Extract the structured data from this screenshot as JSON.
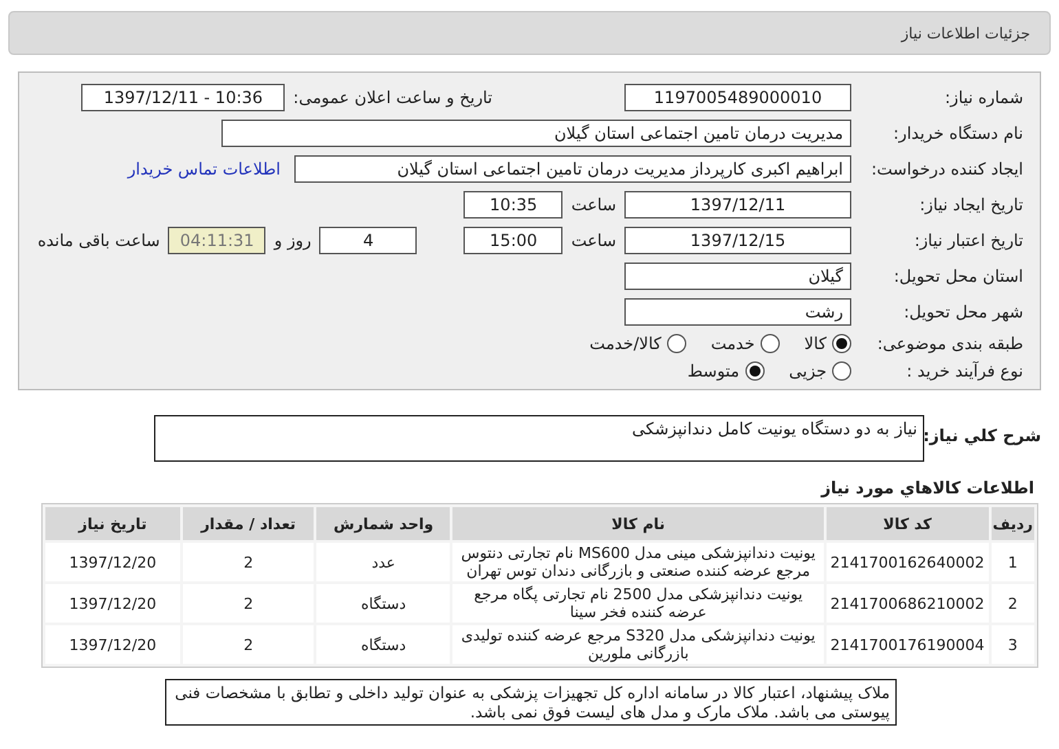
{
  "title": "جزئیات اطلاعات نیاز",
  "form": {
    "need_number": {
      "label": "شماره نیاز:",
      "value": "1197005489000010"
    },
    "announce": {
      "label": "تاریخ و ساعت اعلان عمومی:",
      "value": "1397/12/11 - 10:36"
    },
    "buyer": {
      "label": "نام دستگاه خریدار:",
      "value": "مدیریت درمان تامین اجتماعی استان گیلان"
    },
    "requester": {
      "label": "ایجاد کننده درخواست:",
      "value": "ابراهیم اکبری کارپرداز مدیریت درمان تامین اجتماعی استان گیلان",
      "link": "اطلاعات تماس خریدار"
    },
    "created": {
      "label": "تاریخ ایجاد نیاز:",
      "date": "1397/12/11",
      "time_label": "ساعت",
      "time": "10:35"
    },
    "validity": {
      "label": "تاریخ اعتبار نیاز:",
      "date": "1397/12/15",
      "time_label": "ساعت",
      "time": "15:00",
      "days": "4",
      "days_label": "روز و",
      "remaining": "04:11:31",
      "remaining_label": "ساعت باقی مانده"
    },
    "province": {
      "label": "استان محل تحویل:",
      "value": "گیلان"
    },
    "city": {
      "label": "شهر محل تحویل:",
      "value": "رشت"
    },
    "category": {
      "label": "طبقه بندی موضوعی:",
      "options": [
        {
          "label": "کالا",
          "selected": true
        },
        {
          "label": "خدمت",
          "selected": false
        },
        {
          "label": "کالا/خدمت",
          "selected": false
        }
      ]
    },
    "process": {
      "label": "نوع فرآیند خرید :",
      "options": [
        {
          "label": "جزیی",
          "selected": false
        },
        {
          "label": "متوسط",
          "selected": true
        }
      ]
    }
  },
  "description": {
    "label": "شرح کلي نياز:",
    "value": "نیاز به دو دستگاه یونیت کامل دندانپزشکی"
  },
  "goods": {
    "title": "اطلاعات کالاهاي مورد نياز",
    "columns": [
      "ردیف",
      "کد کالا",
      "نام کالا",
      "واحد شمارش",
      "تعداد / مقدار",
      "تاریخ نیاز"
    ],
    "rows": [
      [
        "1",
        "2141700162640002",
        "یونیت دندانپزشکی مینی مدل MS600 نام تجارتی دنتوس مرجع عرضه کننده صنعتی و بازرگانی دندان توس تهران",
        "عدد",
        "2",
        "1397/12/20"
      ],
      [
        "2",
        "2141700686210002",
        "یونیت دندانپزشکی مدل 2500 نام تجارتی پگاه مرجع عرضه کننده فخر سینا",
        "دستگاه",
        "2",
        "1397/12/20"
      ],
      [
        "3",
        "2141700176190004",
        "یونیت دندانپزشکی مدل S320 مرجع عرضه کننده تولیدی بازرگانی ملورین",
        "دستگاه",
        "2",
        "1397/12/20"
      ]
    ]
  },
  "notes": "ملاک پیشنهاد، اعتبار کالا در سامانه اداره کل تجهیزات پزشکی به عنوان تولید داخلی و تطابق با مشخصات فنی پیوستی می باشد. ملاک مارک و مدل های لیست فوق نمی باشد."
}
